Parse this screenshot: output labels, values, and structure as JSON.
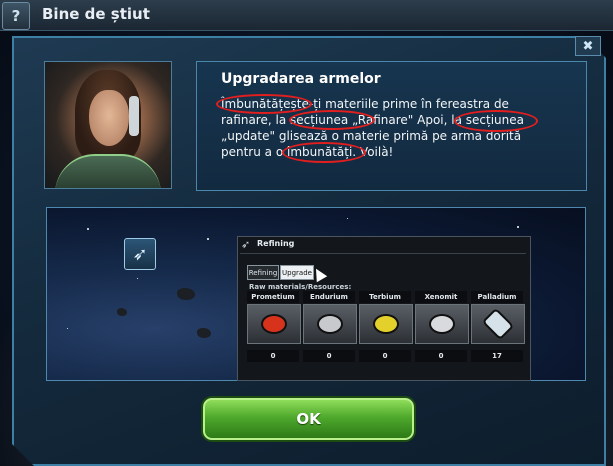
{
  "window": {
    "title": "Bine de știut",
    "help_label": "?",
    "close_label": "✖"
  },
  "tip": {
    "heading": "Upgradarea armelor",
    "body": "Îmbunătățește-ți materiile prime în fereastra de rafinare, la secțiunea „Rafinare\" Apoi, la secțiunea „update\" glisează o materie primă pe arma dorită pentru a o îmbunătăți. Voilà!"
  },
  "refining": {
    "title": "Refining",
    "tabs": [
      "Refining",
      "Upgrade"
    ],
    "active_tab": "Upgrade",
    "section_label": "Raw materials/Resources:",
    "resources": [
      {
        "name": "Prometium",
        "count": "0",
        "color": "#d6321c"
      },
      {
        "name": "Endurium",
        "count": "0",
        "color": "#c7c9cc"
      },
      {
        "name": "Terbium",
        "count": "0",
        "color": "#e3d02a"
      },
      {
        "name": "Xenomit",
        "count": "0",
        "color": "#d8dadd"
      },
      {
        "name": "Palladium",
        "count": "17",
        "color": "#d6e2ea"
      }
    ]
  },
  "actions": {
    "ok_label": "OK"
  },
  "colors": {
    "accent": "#3e7fa6",
    "ok_green": "#4fa92c",
    "highlight_red": "#e21e1e"
  }
}
